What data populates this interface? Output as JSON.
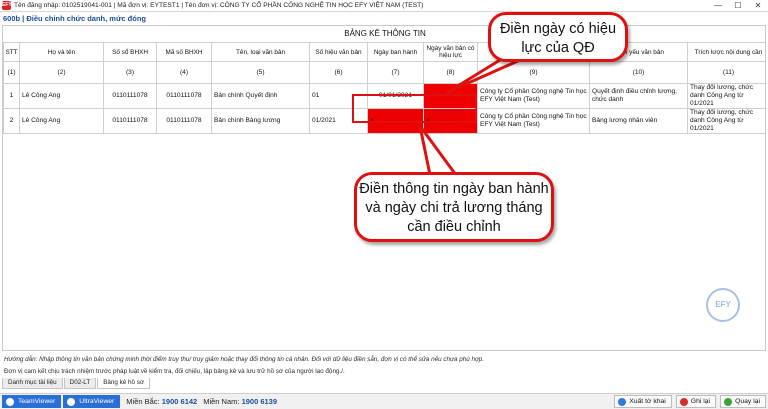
{
  "window": {
    "title": "Tên đăng nhập: 0102519041-001 | Mã đơn vị: EYTEST1 | Tên đơn vị: CÔNG TY CỔ PHẦN CÔNG NGHỆ TIN HỌC EFY VIỆT NAM (TEST)",
    "app_icon_label": "EFY",
    "minimize": "—",
    "maximize": "☐",
    "close": "✕"
  },
  "form_title": "600b | Điều chỉnh chức danh, mức đóng",
  "table": {
    "title": "BẢNG KÊ THÔNG TIN",
    "columns": [
      "STT",
      "Họ và tên",
      "Số sổ BHXH",
      "Mã số BHXH",
      "Tên, loại văn bản",
      "Số hiệu văn bản",
      "Ngày ban hành",
      "Ngày văn bản có hiệu lực",
      "Cơ quan ban hành",
      "Trích yếu văn bản",
      "Trích lược nội dung cần"
    ],
    "column_numbers": [
      "(1)",
      "(2)",
      "(3)",
      "(4)",
      "(5)",
      "(6)",
      "(7)",
      "(8)",
      "(9)",
      "(10)",
      "(11)"
    ],
    "rows": [
      {
        "stt": "1",
        "name": "Lê Công Ang",
        "so_so": "0110111078",
        "ma_so": "0110111078",
        "ten_vb": "Bản chính Quyết định",
        "so_hieu": "01",
        "ngay_bh": "01/01/2021",
        "ngay_hl": "×",
        "co_quan": "Công ty Cổ phần Công nghệ Tin học EFY Việt Nam (Test)",
        "trich_yeu": "Quyết định điều chỉnh lương, chức danh",
        "trich_luoc": "Thay đổi lương, chức danh Công Ang từ 01/2021"
      },
      {
        "stt": "2",
        "name": "Lê Công Ang",
        "so_so": "0110111078",
        "ma_so": "0110111078",
        "ten_vb": "Bản chính Bảng lương",
        "so_hieu": "01/2021",
        "ngay_bh": "×",
        "ngay_hl": "×",
        "co_quan": "Công ty Cổ phần Công nghệ Tin học EFY Việt Nam (Test)",
        "trich_yeu": "Bảng lương nhân viên",
        "trich_luoc": "Thay đổi lương, chức danh Công Ang từ 01/2021"
      }
    ]
  },
  "callouts": {
    "top": "Điền ngày có hiệu lực của QĐ",
    "bottom": "Điền thông tin ngày ban hành và ngày chi trả lương tháng cần điều chỉnh"
  },
  "watermark": "EFY",
  "guide_text": "Hướng dẫn: Nhập thông tin văn bản chứng minh thời điểm truy thu/ truy giảm hoặc thay đổi thông tin cá nhân. Đối với dữ liệu điền sẵn, đơn vị có thể sửa nếu chưa phù hợp.",
  "commit_text": "Đơn vị cam kết chịu trách nhiệm trước pháp luật về kiểm tra, đối chiếu, lập bảng kê và lưu trữ hồ sơ của người lao động./.",
  "tabs": [
    "Danh mục tài liệu",
    "D02-LT",
    "Bảng kê hồ sơ"
  ],
  "status": {
    "teamviewer": "TeamViewer",
    "ultraviewer": "UltraViewer",
    "north_label": "Miền Bắc:",
    "north_phone": "1900 6142",
    "south_label": "Miền Nam:",
    "south_phone": "1900 6139",
    "export": "Xuất tờ khai",
    "save": "Ghi lại",
    "back": "Quay lại"
  },
  "colors": {
    "accent_red": "#e01010",
    "cell_red": "#ee0000",
    "brand_blue": "#1d4e9a"
  }
}
